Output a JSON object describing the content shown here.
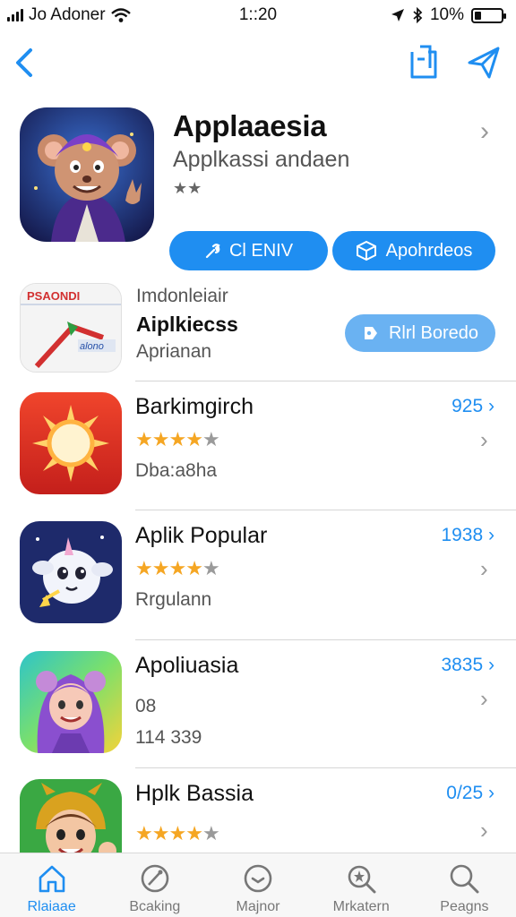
{
  "status_bar": {
    "carrier": "Jo Adoner",
    "time": "1::20",
    "battery_text": "10%",
    "battery_level": 0.25
  },
  "nav": {
    "back_icon": "chevron-left-icon",
    "share_icon": "share-icon",
    "send_icon": "send-icon"
  },
  "featured": {
    "title": "Applaaesia",
    "subtitle": "Applkassi andaen",
    "rating_text": "★★",
    "get_button": {
      "icon": "wrench-icon",
      "label": "Cl ENIV"
    },
    "open_button": {
      "icon": "box-icon",
      "label": "Apohrdeos"
    }
  },
  "second_row": {
    "icon_text": "PSAONDI",
    "icon_subtext": "alono",
    "small_text": "Imdonleiair",
    "title": "Aiplkiecss",
    "subtitle": "Aprianan",
    "button": {
      "icon": "tag-icon",
      "label": "Rlrl Boredo"
    }
  },
  "apps": [
    {
      "title": "Barkimgirch",
      "value": "925 ›",
      "rating": 4,
      "subtitle": "Dba:a8ha",
      "icon": "sun-app-icon"
    },
    {
      "title": "Aplik Popular",
      "value": "1938 ›",
      "rating": 4,
      "subtitle": "Rrgulann",
      "icon": "unicorn-app-icon"
    },
    {
      "title": "Apoliuasia",
      "value": "3835 ›",
      "rating": null,
      "meta": "08",
      "subtitle": "114 339",
      "icon": "girl-app-icon"
    },
    {
      "title": "Hplk Bassia",
      "value": "0/25 ›",
      "rating": 4,
      "subtitle": "",
      "icon": "hero-app-icon"
    }
  ],
  "tabs": [
    {
      "label": "Rlaiaae",
      "icon": "home-icon",
      "active": true
    },
    {
      "label": "Bcaking",
      "icon": "compass-icon",
      "active": false
    },
    {
      "label": "Majnor",
      "icon": "clock-icon",
      "active": false
    },
    {
      "label": "Mrkatern",
      "icon": "magnifier-star-icon",
      "active": false
    },
    {
      "label": "Peagns",
      "icon": "search-icon",
      "active": false
    }
  ],
  "colors": {
    "accent": "#1f8ef1",
    "star": "#f5a623",
    "divider": "#d6d6d6"
  }
}
